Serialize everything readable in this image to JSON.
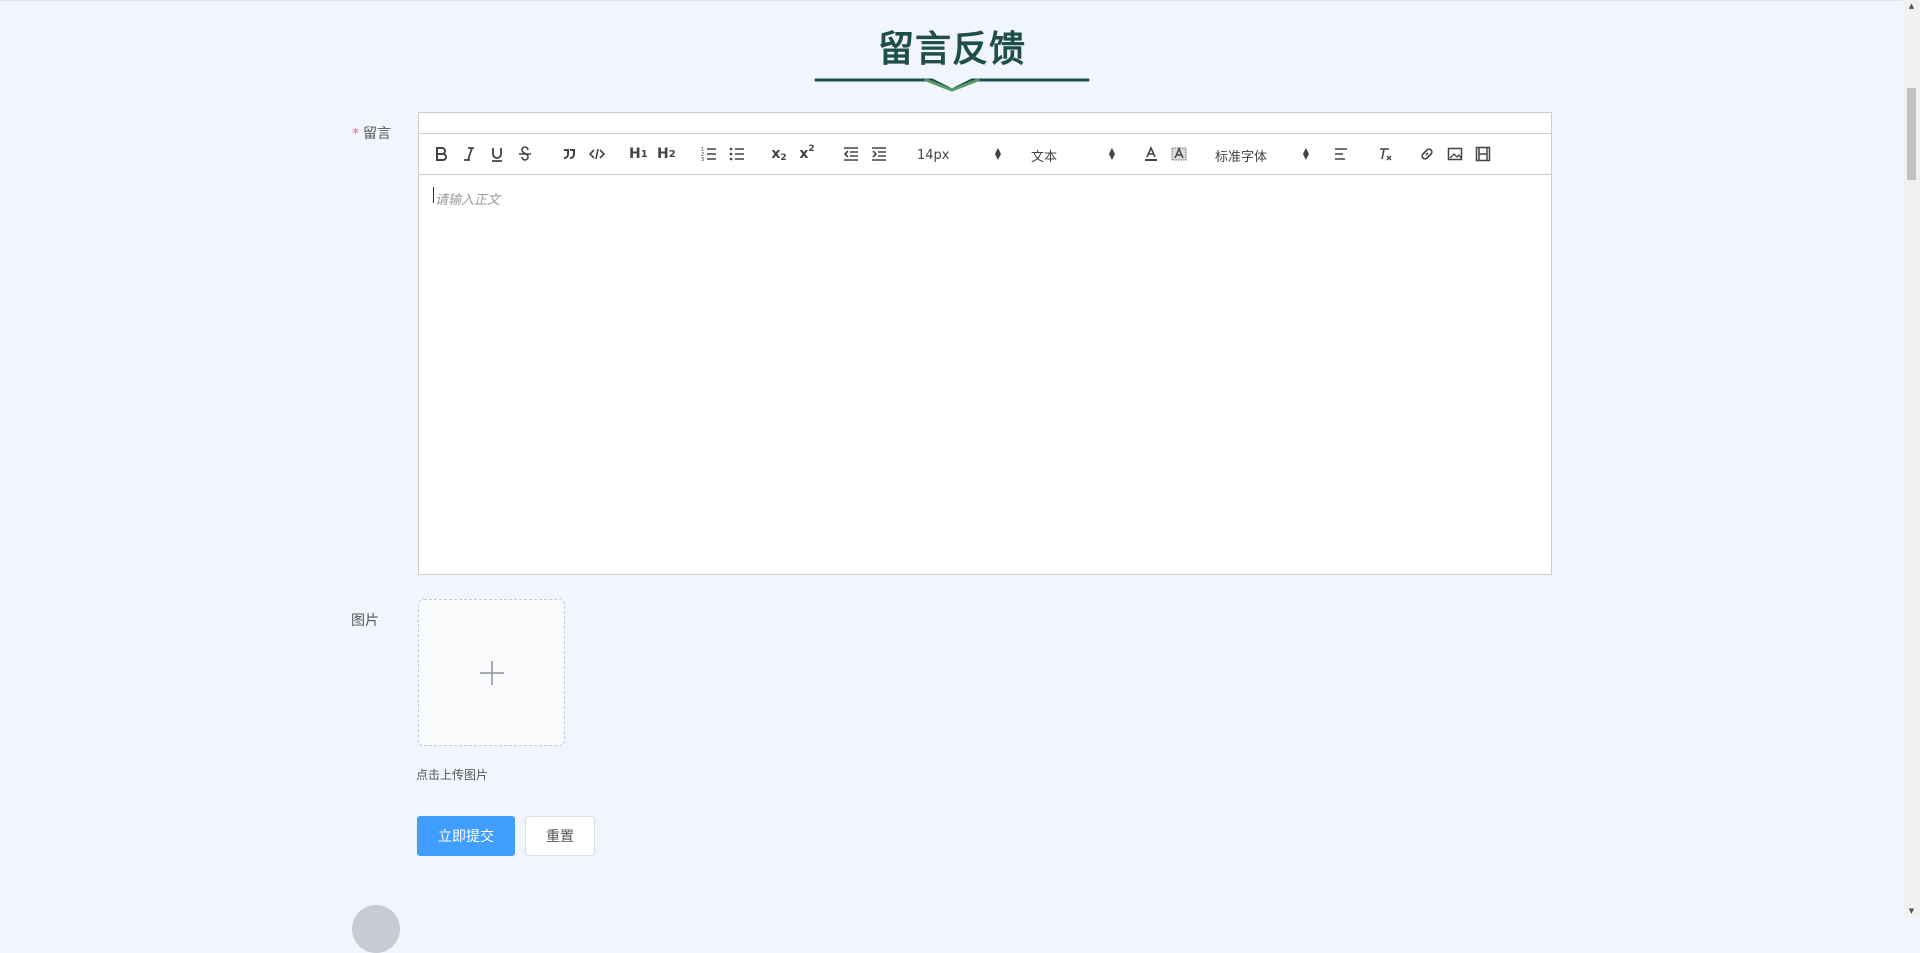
{
  "page": {
    "title": "留言反馈",
    "accent_color": "#1f4e4c",
    "deco_color": "#5a9a6a"
  },
  "form": {
    "message_label": "留言",
    "required_mark": "*",
    "image_label": "图片",
    "upload_tip": "点击上传图片",
    "submit_label": "立即提交",
    "reset_label": "重置"
  },
  "editor": {
    "placeholder": "请输入正文",
    "font_size": "14px",
    "header_picker": "文本",
    "font_picker": "标准字体",
    "toolbar_icons": [
      "bold-icon",
      "italic-icon",
      "underline-icon",
      "strike-icon",
      "blockquote-icon",
      "code-block-icon",
      "h1-icon",
      "h2-icon",
      "ordered-list-icon",
      "bullet-list-icon",
      "subscript-icon",
      "superscript-icon",
      "outdent-icon",
      "indent-icon",
      "font-color-icon",
      "background-color-icon",
      "align-icon",
      "clean-format-icon",
      "link-icon",
      "image-icon",
      "video-icon"
    ]
  },
  "colors": {
    "primary": "#409eff",
    "background": "#f1f5fe",
    "required": "#f56c6c"
  }
}
